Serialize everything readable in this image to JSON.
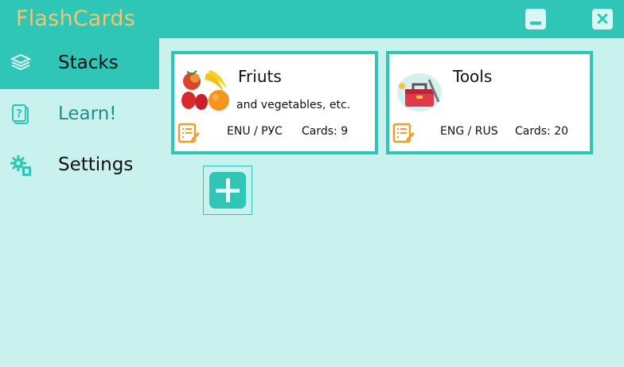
{
  "app": {
    "title": "FlashCards"
  },
  "window": {
    "minimize_icon": "minimize-icon",
    "close_icon": "close-icon"
  },
  "sidebar": {
    "items": [
      {
        "label": "Stacks",
        "icon": "stack-icon",
        "active": true
      },
      {
        "label": "Learn!",
        "icon": "question-cards-icon",
        "active": false
      },
      {
        "label": "Settings",
        "icon": "gear-icon",
        "active": false
      }
    ]
  },
  "stacks": [
    {
      "name": "Friuts",
      "description": "and vegetables, etc.",
      "languages": "ENU / РУС",
      "cards": "Cards: 9",
      "image": "fruits-image"
    },
    {
      "name": "Tools",
      "description": "",
      "languages": "ENG / RUS",
      "cards": "Cards: 20",
      "image": "toolbox-image"
    }
  ],
  "add_button": {
    "icon": "plus-icon"
  },
  "colors": {
    "accent": "#2fc6b8",
    "background": "#c9f2ee",
    "title": "#f4c56f",
    "edit_icon": "#f29a2e"
  }
}
